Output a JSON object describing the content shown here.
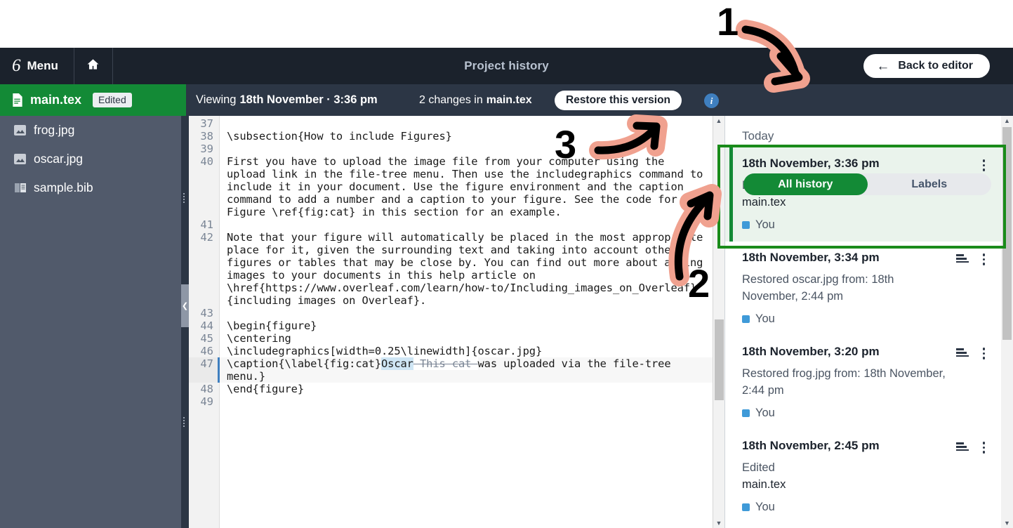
{
  "header": {
    "menu_label": "Menu",
    "home_icon": "home-icon",
    "logo_glyph": "6",
    "title": "Project history",
    "back_label": "Back to editor",
    "back_arrow": "←"
  },
  "toolbar": {
    "file_tab": {
      "name": "main.tex",
      "badge": "Edited",
      "icon": "file-icon"
    },
    "viewing_label": "Viewing",
    "viewing_value": "18th November · 3:36 pm",
    "changes_text": "2 changes in",
    "changes_file": "main.tex",
    "restore_label": "Restore this version",
    "info_icon": "info-icon",
    "segments": [
      {
        "label": "All history",
        "active": true
      },
      {
        "label": "Labels",
        "active": false
      }
    ]
  },
  "filetree": {
    "items": [
      {
        "name": "frog.jpg",
        "icon": "image-icon"
      },
      {
        "name": "oscar.jpg",
        "icon": "image-icon"
      },
      {
        "name": "sample.bib",
        "icon": "book-icon"
      }
    ]
  },
  "editor": {
    "collapse_icon": "chevron-left-icon",
    "scroll_up_icon": "▲",
    "scroll_down_icon": "▼",
    "lines": [
      {
        "no": "37",
        "text": ""
      },
      {
        "no": "38",
        "text": "\\subsection{How to include Figures}"
      },
      {
        "no": "39",
        "text": ""
      },
      {
        "no": "40",
        "text": "First you have to upload the image file from your computer using the upload link in the file-tree menu. Then use the includegraphics command to include it in your document. Use the figure environment and the caption command to add a number and a caption to your figure. See the code for Figure \\ref{fig:cat} in this section for an example."
      },
      {
        "no": "41",
        "text": ""
      },
      {
        "no": "42",
        "text": "Note that your figure will automatically be placed in the most appropriate place for it, given the surrounding text and taking into account other figures or tables that may be close by. You can find out more about adding images to your documents in this help article on \\href{https://www.overleaf.com/learn/how-to/Including_images_on_Overleaf}{including images on Overleaf}."
      },
      {
        "no": "43",
        "text": ""
      },
      {
        "no": "44",
        "text": "\\begin{figure}"
      },
      {
        "no": "45",
        "text": "\\centering"
      },
      {
        "no": "46",
        "text": "\\includegraphics[width=0.25\\linewidth]{oscar.jpg}"
      },
      {
        "no": "47",
        "text": "\\caption{\\label{fig:cat}",
        "inserted": "Oscar",
        "deleted": " This cat ",
        "tail": "was uploaded via the file-tree menu.}",
        "highlight": true
      },
      {
        "no": "48",
        "text": "\\end{figure}"
      },
      {
        "no": "49",
        "text": ""
      }
    ]
  },
  "history": {
    "group_label": "Today",
    "items": [
      {
        "time": "18th November, 3:36 pm",
        "action": "Edited",
        "file": "main.tex",
        "user": "You",
        "selected": true,
        "has_compare": false
      },
      {
        "time": "18th November, 3:34 pm",
        "action": "Restored oscar.jpg from: 18th November, 2:44 pm",
        "file": "",
        "user": "You",
        "selected": false,
        "has_compare": true
      },
      {
        "time": "18th November, 3:20 pm",
        "action": "Restored frog.jpg from: 18th November, 2:44 pm",
        "file": "",
        "user": "You",
        "selected": false,
        "has_compare": true
      },
      {
        "time": "18th November, 2:45 pm",
        "action": "Edited",
        "file": "main.tex",
        "user": "You",
        "selected": false,
        "has_compare": true
      }
    ],
    "compare_icon": "compare-icon",
    "menu_icon": "kebab-menu-icon",
    "scroll_up_icon": "▲",
    "scroll_down_icon": "▼"
  },
  "annotations": [
    {
      "id": "1",
      "label": "1",
      "target": "all-history-toggle"
    },
    {
      "id": "2",
      "label": "2",
      "target": "selected-revision"
    },
    {
      "id": "3",
      "label": "3",
      "target": "restore-this-version-button"
    }
  ],
  "colors": {
    "accent_green": "#138a36",
    "header_dark": "#1b222c",
    "toolbar_dark": "#2c3645",
    "sidebar": "#515a6b",
    "annotation_pink": "#f0a18f",
    "highlight_box_green": "#1a8b1a",
    "insert_blue": "#cfe6f5",
    "user_chip_blue": "#3f9ad8"
  }
}
